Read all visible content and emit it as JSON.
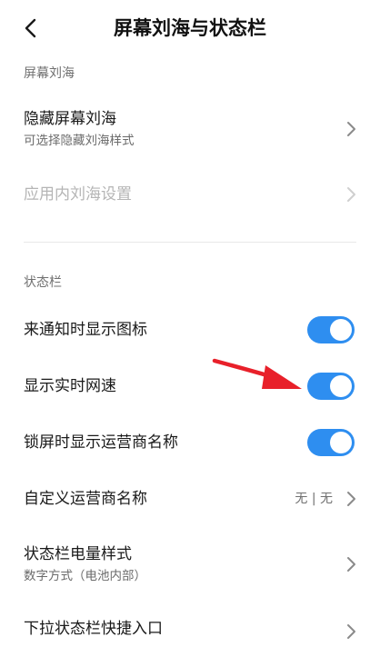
{
  "header": {
    "title": "屏幕刘海与状态栏"
  },
  "sections": {
    "notch": {
      "label": "屏幕刘海",
      "hide_notch": {
        "title": "隐藏屏幕刘海",
        "subtitle": "可选择隐藏刘海样式"
      },
      "in_app_notch": {
        "title": "应用内刘海设置",
        "state": "disabled"
      }
    },
    "status_bar": {
      "label": "状态栏",
      "show_notification_icons": {
        "title": "来通知时显示图标",
        "enabled": true
      },
      "show_network_speed": {
        "title": "显示实时网速",
        "enabled": true
      },
      "lockscreen_carrier": {
        "title": "锁屏时显示运营商名称",
        "enabled": true
      },
      "custom_carrier": {
        "title": "自定义运营商名称",
        "value": "无 | 无"
      },
      "battery_style": {
        "title": "状态栏电量样式",
        "subtitle": "数字方式（电池内部）"
      },
      "pulldown_shortcut": {
        "title": "下拉状态栏快捷入口"
      }
    }
  },
  "colors": {
    "accent": "#2e8ef0",
    "annotation_arrow": "#e8202a",
    "text_primary": "#1a1a1a",
    "text_secondary": "#707070",
    "text_disabled": "#b5b5b5"
  }
}
